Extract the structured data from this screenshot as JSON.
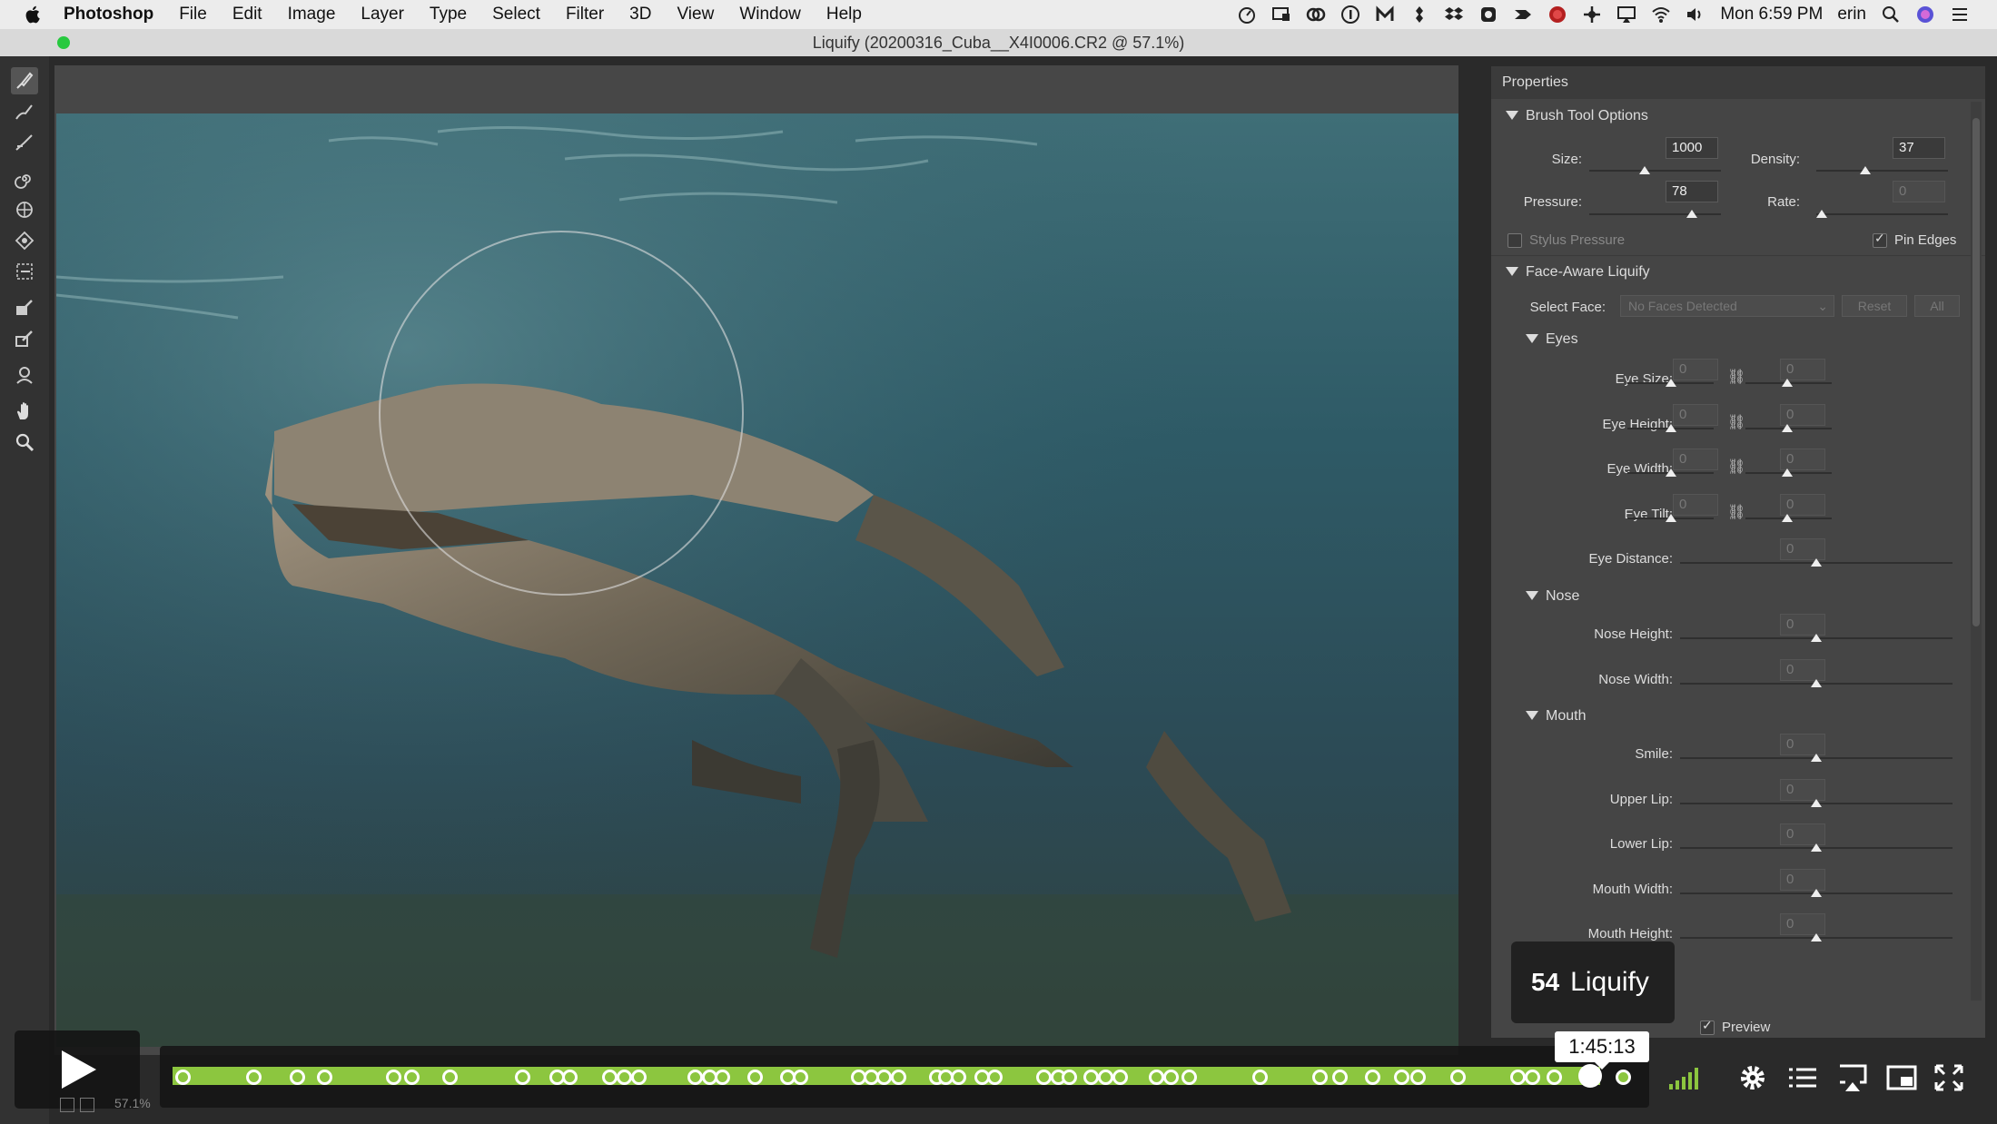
{
  "menubar": {
    "items": [
      "Photoshop",
      "File",
      "Edit",
      "Image",
      "Layer",
      "Type",
      "Select",
      "Filter",
      "3D",
      "View",
      "Window",
      "Help"
    ],
    "clock": "Mon 6:59 PM",
    "user": "erin"
  },
  "window": {
    "title": "Liquify (20200316_Cuba__X4I0006.CR2 @ 57.1%)"
  },
  "panel": {
    "title": "Properties",
    "brush_tool_options": {
      "header": "Brush Tool Options",
      "size_label": "Size:",
      "size_value": "1000",
      "size_level": 0.42,
      "density_label": "Density:",
      "density_value": "37",
      "density_level": 0.37,
      "pressure_label": "Pressure:",
      "pressure_value": "78",
      "pressure_level": 0.78,
      "rate_label": "Rate:",
      "rate_value": "0",
      "rate_level": 0.04,
      "stylus_pressure": "Stylus Pressure",
      "pin_edges": "Pin Edges"
    },
    "face_aware": {
      "header": "Face-Aware Liquify",
      "select_face_label": "Select Face:",
      "select_face_value": "No Faces Detected",
      "reset": "Reset",
      "all": "All",
      "eyes": {
        "header": "Eyes",
        "rows": [
          {
            "label": "Eye Size:",
            "left": "0",
            "right": "0",
            "linked": true
          },
          {
            "label": "Eye Height:",
            "left": "0",
            "right": "0",
            "linked": true
          },
          {
            "label": "Eye Width:",
            "left": "0",
            "right": "0",
            "linked": true
          },
          {
            "label": "Eye Tilt:",
            "left": "0",
            "right": "0",
            "linked": true
          },
          {
            "label": "Eye Distance:",
            "value": "0"
          }
        ]
      },
      "nose": {
        "header": "Nose",
        "rows": [
          {
            "label": "Nose Height:",
            "value": "0"
          },
          {
            "label": "Nose Width:",
            "value": "0"
          }
        ]
      },
      "mouth": {
        "header": "Mouth",
        "rows": [
          {
            "label": "Smile:",
            "value": "0"
          },
          {
            "label": "Upper Lip:",
            "value": "0"
          },
          {
            "label": "Lower Lip:",
            "value": "0"
          },
          {
            "label": "Mouth Width:",
            "value": "0"
          },
          {
            "label": "Mouth Height:",
            "value": "0"
          }
        ]
      }
    },
    "preview": "Preview"
  },
  "video": {
    "chapter_number": "54",
    "chapter_title": "Liquify",
    "time_tooltip": "1:45:13",
    "progress": 0.98,
    "accent": "#8cc63f"
  },
  "status": {
    "zoom": "57.1%"
  },
  "icons": [
    "apple-icon",
    "forward-warp-tool-icon",
    "reconstruct-tool-icon",
    "smooth-tool-icon",
    "twirl-tool-icon",
    "pucker-tool-icon",
    "bloat-tool-icon",
    "push-left-tool-icon",
    "freeze-mask-tool-icon",
    "thaw-mask-tool-icon",
    "face-tool-icon",
    "hand-tool-icon",
    "zoom-tool-icon",
    "play-icon",
    "volume-icon",
    "settings-icon",
    "chapters-icon",
    "airplay-icon",
    "pip-icon",
    "fullscreen-icon"
  ]
}
